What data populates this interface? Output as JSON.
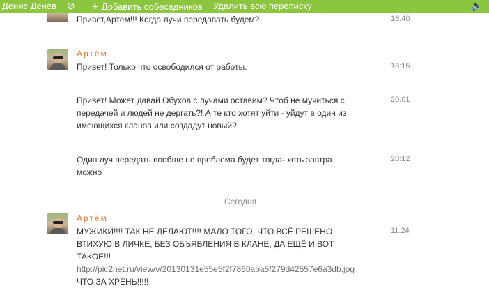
{
  "topbar": {
    "contact_name": "Денис Денёв",
    "ban_icon": "ban-icon",
    "add_label": "Добавить собеседников",
    "delete_label": "Удалить всю переписку",
    "sound_icon": "speaker-icon"
  },
  "messages": [
    {
      "author": "",
      "text": "Привет,Артем!!! Когда лучи передавать будем?",
      "time": "16:40"
    },
    {
      "author": "Артём",
      "text": "Привет! Только что освободился от работы.",
      "time": "18:15"
    },
    {
      "author": "",
      "text": "Привет! Может давай Обухов с лучами оставим? Чтоб не мучиться с передачей и людей не дергать?! А те кто хотят уйти - уйдут в один из имеющихся кланов или создадут новый?",
      "time": "20:01"
    },
    {
      "author": "",
      "text": "Один луч передать вообще не проблема будет тогда- хоть завтра можно",
      "time": "20:12"
    }
  ],
  "divider": {
    "label": "Сегодня"
  },
  "last_message": {
    "author": "Артём",
    "text_before": "МУЖИКИ!!!! ТАК НЕ ДЕЛАЮТ!!!! МАЛО ТОГО, ЧТО ВСЁ РЕШЕНО ВТИХУЮ В ЛИЧКЕ, БЕЗ ОБЪЯВЛЕНИЯ В КЛАНЕ, ДА ЕЩЁ И ВОТ ТАКОЕ!!!",
    "link": "http://pic2net.ru/view/v/20130131e55e5f2f7860aba5f279d42557e6a3db.jpg",
    "text_after": "ЧТО ЗА ХРЕНЬ!!!!!",
    "time": "11:24"
  }
}
